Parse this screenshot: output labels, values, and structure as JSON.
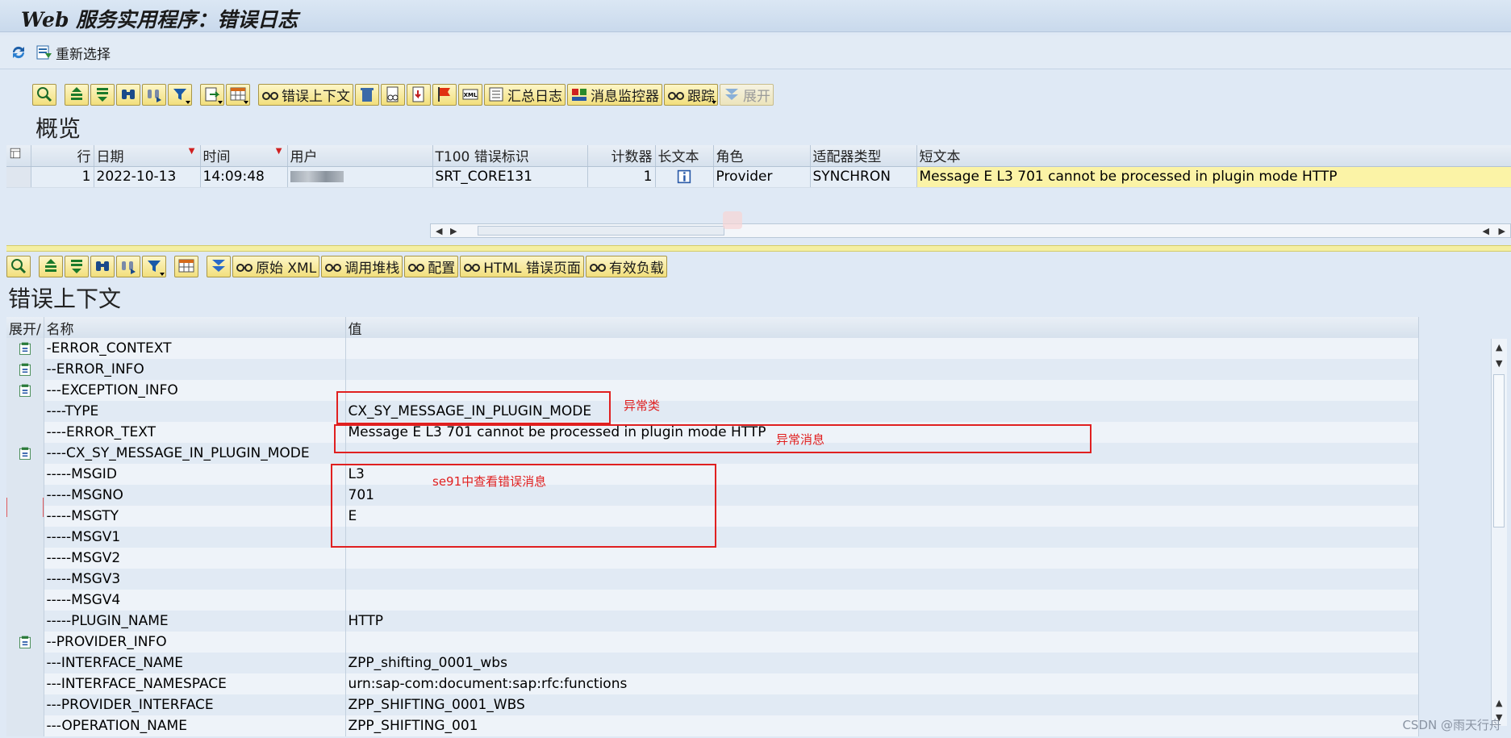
{
  "window": {
    "title": "Web 服务实用程序：错误日志"
  },
  "app_toolbar": {
    "reselect_label": "重新选择"
  },
  "overview": {
    "title": "概览",
    "toolbar": {
      "error_context": "错误上下文",
      "summary_log": "汇总日志",
      "message_monitor": "消息监控器",
      "trace": "跟踪",
      "expand": "展开"
    },
    "columns": [
      "行",
      "日期",
      "时间",
      "用户",
      "T100 错误标识",
      "计数器",
      "长文本",
      "角色",
      "适配器类型",
      "短文本"
    ],
    "rows": [
      {
        "row": "1",
        "date": "2022-10-13",
        "time": "14:09:48",
        "user": "",
        "t100": "SRT_CORE131",
        "counter": "1",
        "role": "Provider",
        "adapter": "SYNCHRON",
        "short_text": "Message E L3 701 cannot be processed in plugin mode HTTP"
      }
    ]
  },
  "error_context": {
    "title": "错误上下文",
    "toolbar": {
      "raw_xml": "原始 XML",
      "call_stack": "调用堆栈",
      "config": "配置",
      "html_error_page": "HTML 错误页面",
      "payload": "有效负载"
    },
    "columns": {
      "expand": "展开/",
      "name": "名称",
      "value": "值"
    },
    "rows": [
      {
        "expand": true,
        "name": "-ERROR_CONTEXT",
        "value": ""
      },
      {
        "expand": true,
        "name": "--ERROR_INFO",
        "value": ""
      },
      {
        "expand": true,
        "name": "---EXCEPTION_INFO",
        "value": ""
      },
      {
        "expand": false,
        "name": "----TYPE",
        "value": "CX_SY_MESSAGE_IN_PLUGIN_MODE"
      },
      {
        "expand": false,
        "name": "----ERROR_TEXT",
        "value": "Message E L3 701 cannot be processed in plugin mode HTTP"
      },
      {
        "expand": true,
        "name": "----CX_SY_MESSAGE_IN_PLUGIN_MODE",
        "value": ""
      },
      {
        "expand": false,
        "name": "-----MSGID",
        "value": "L3"
      },
      {
        "expand": false,
        "name": "-----MSGNO",
        "value": "701"
      },
      {
        "expand": false,
        "name": "-----MSGTY",
        "value": "E"
      },
      {
        "expand": false,
        "name": "-----MSGV1",
        "value": ""
      },
      {
        "expand": false,
        "name": "-----MSGV2",
        "value": ""
      },
      {
        "expand": false,
        "name": "-----MSGV3",
        "value": ""
      },
      {
        "expand": false,
        "name": "-----MSGV4",
        "value": ""
      },
      {
        "expand": false,
        "name": "-----PLUGIN_NAME",
        "value": "HTTP"
      },
      {
        "expand": true,
        "name": "--PROVIDER_INFO",
        "value": ""
      },
      {
        "expand": false,
        "name": "---INTERFACE_NAME",
        "value": "ZPP_shifting_0001_wbs"
      },
      {
        "expand": false,
        "name": "---INTERFACE_NAMESPACE",
        "value": "urn:sap-com:document:sap:rfc:functions"
      },
      {
        "expand": false,
        "name": "---PROVIDER_INTERFACE",
        "value": "ZPP_SHIFTING_0001_WBS"
      },
      {
        "expand": false,
        "name": "---OPERATION_NAME",
        "value": "ZPP_SHIFTING_001"
      }
    ]
  },
  "annotations": {
    "exception_class": "异常类",
    "exception_message": "异常消息",
    "se91_hint": "se91中查看错误消息"
  },
  "watermark": "CSDN @雨天行舟",
  "colors": {
    "accent_red": "#e02020",
    "highlight_yellow": "#fbf3a6"
  }
}
